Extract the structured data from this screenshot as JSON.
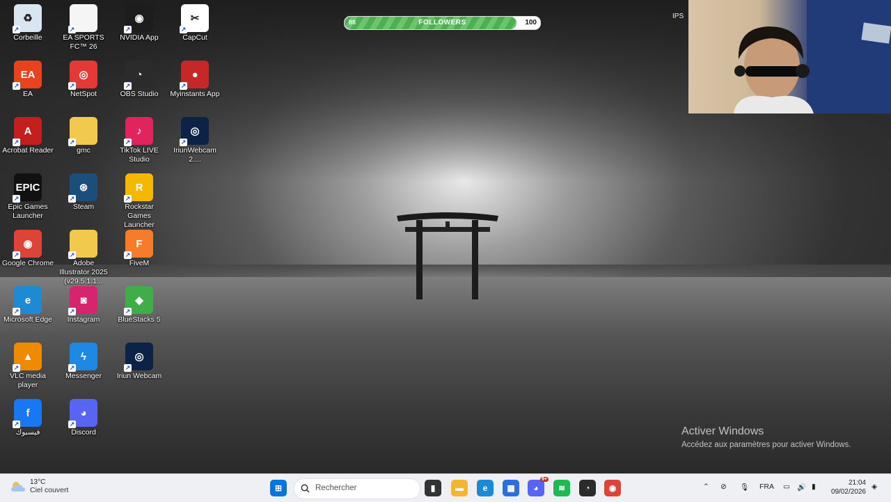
{
  "desktop": {
    "icons": [
      {
        "label": "Corbeille",
        "glyph": "♻",
        "color": "#d9e6f2",
        "icon": "recycle-bin-icon"
      },
      {
        "label": "EA SPORTS FC™ 26",
        "glyph": "",
        "color": "#f5f5f5",
        "icon": "document-icon"
      },
      {
        "label": "NVIDIA App",
        "glyph": "◉",
        "color": "#1d1d1d",
        "icon": "nvidia-icon"
      },
      {
        "label": "CapCut",
        "glyph": "✂",
        "color": "#ffffff",
        "icon": "capcut-icon"
      },
      {
        "label": "EA",
        "glyph": "EA",
        "color": "#e8421e",
        "icon": "ea-icon"
      },
      {
        "label": "NetSpot",
        "glyph": "◎",
        "color": "#e53935",
        "icon": "netspot-icon"
      },
      {
        "label": "OBS Studio",
        "glyph": "◔",
        "color": "#2b2b2b",
        "icon": "obs-icon"
      },
      {
        "label": "Myinstants App",
        "glyph": "●",
        "color": "#c62828",
        "icon": "myinstants-icon"
      },
      {
        "label": "Acrobat Reader",
        "glyph": "A",
        "color": "#c41f1f",
        "icon": "acrobat-icon"
      },
      {
        "label": "gmc",
        "glyph": "",
        "color": "#f2c94c",
        "icon": "folder-icon"
      },
      {
        "label": "TikTok LIVE Studio",
        "glyph": "♪",
        "color": "#e0245e",
        "icon": "tiktok-icon"
      },
      {
        "label": "IriunWebcam 2....",
        "glyph": "◎",
        "color": "#0d2345",
        "icon": "iriun-webcam-icon"
      },
      {
        "label": "Epic Games Launcher",
        "glyph": "EPIC",
        "color": "#111111",
        "icon": "epic-games-icon"
      },
      {
        "label": "Steam",
        "glyph": "⊛",
        "color": "#1b4f7a",
        "icon": "steam-icon"
      },
      {
        "label": "Rockstar Games Launcher",
        "glyph": "R",
        "color": "#f5b800",
        "icon": "rockstar-icon"
      },
      {
        "label": "",
        "glyph": "",
        "color": "",
        "icon": ""
      },
      {
        "label": "Google Chrome",
        "glyph": "◉",
        "color": "#db4437",
        "icon": "chrome-icon"
      },
      {
        "label": "Adobe Illustrator 2025 (v29.5.1.1...",
        "glyph": "",
        "color": "#f2c94c",
        "icon": "folder-icon"
      },
      {
        "label": "FiveM",
        "glyph": "F",
        "color": "#f57c2b",
        "icon": "fivem-icon"
      },
      {
        "label": "",
        "glyph": "",
        "color": "",
        "icon": ""
      },
      {
        "label": "Microsoft Edge",
        "glyph": "e",
        "color": "#1f8ad4",
        "icon": "edge-icon"
      },
      {
        "label": "Instagram",
        "glyph": "◙",
        "color": "#d6246e",
        "icon": "instagram-icon"
      },
      {
        "label": "BlueStacks 5",
        "glyph": "◆",
        "color": "#3fae49",
        "icon": "bluestacks-icon"
      },
      {
        "label": "",
        "glyph": "",
        "color": "",
        "icon": ""
      },
      {
        "label": "VLC media player",
        "glyph": "▲",
        "color": "#f08a00",
        "icon": "vlc-icon"
      },
      {
        "label": "Messenger",
        "glyph": "ϟ",
        "color": "#1e88e5",
        "icon": "messenger-icon"
      },
      {
        "label": "Iriun Webcam",
        "glyph": "◎",
        "color": "#0d2345",
        "icon": "iriun-webcam-icon"
      },
      {
        "label": "",
        "glyph": "",
        "color": "",
        "icon": ""
      },
      {
        "label": "فيسبوك",
        "glyph": "f",
        "color": "#1877f2",
        "icon": "facebook-icon"
      },
      {
        "label": "Discord",
        "glyph": "◕",
        "color": "#5865f2",
        "icon": "discord-icon"
      }
    ]
  },
  "followers_bar": {
    "start": "88",
    "label": "FOLLOWERS",
    "end": "100",
    "progress": 0.88
  },
  "overlay_text": {
    "ips": "IPS"
  },
  "activation": {
    "title": "Activer Windows",
    "subtitle": "Accédez aux paramètres pour activer Windows."
  },
  "taskbar": {
    "weather": {
      "temp": "13°C",
      "desc": "Ciel couvert"
    },
    "search_placeholder": "Rechercher",
    "apps": [
      {
        "name": "start-button",
        "glyph": "⊞",
        "color": "#0a74d8"
      },
      {
        "name": "task-view-button",
        "glyph": "▮",
        "color": "#333333"
      },
      {
        "name": "file-explorer-button",
        "glyph": "▬",
        "color": "#f2b632"
      },
      {
        "name": "edge-button",
        "glyph": "e",
        "color": "#1f8ad4"
      },
      {
        "name": "store-button",
        "glyph": "▦",
        "color": "#2a6fdb"
      },
      {
        "name": "discord-button",
        "glyph": "◕",
        "color": "#5865f2"
      },
      {
        "name": "spotify-button",
        "glyph": "≋",
        "color": "#1db954"
      },
      {
        "name": "obs-button",
        "glyph": "◔",
        "color": "#2b2b2b"
      },
      {
        "name": "chrome-button",
        "glyph": "◉",
        "color": "#db4437"
      }
    ],
    "discord_badge": "9+",
    "language": "FRA",
    "time": "21:04",
    "date": "09/02/2026"
  }
}
